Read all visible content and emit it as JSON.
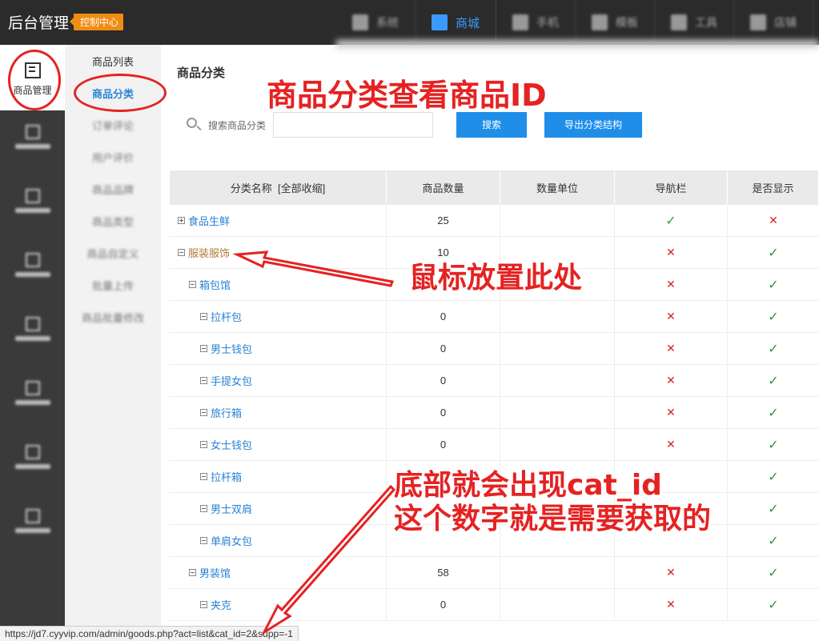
{
  "topbar": {
    "brand": "后台管理",
    "badge": "控制中心",
    "nav": [
      {
        "label": "系统",
        "active": false
      },
      {
        "label": "商城",
        "active": true
      },
      {
        "label": "手机",
        "active": false
      },
      {
        "label": "模板",
        "active": false
      },
      {
        "label": "工具",
        "active": false
      },
      {
        "label": "店铺",
        "active": false
      }
    ]
  },
  "sidebar": {
    "main_label": "商品管理"
  },
  "subnav": {
    "items": [
      {
        "label": "商品列表",
        "active": false,
        "blurred": false
      },
      {
        "label": "商品分类",
        "active": true,
        "blurred": false
      },
      {
        "label": "订单评论",
        "active": false,
        "blurred": true
      },
      {
        "label": "用户评价",
        "active": false,
        "blurred": true
      },
      {
        "label": "商品品牌",
        "active": false,
        "blurred": true
      },
      {
        "label": "商品类型",
        "active": false,
        "blurred": true
      },
      {
        "label": "商品自定义",
        "active": false,
        "blurred": true
      },
      {
        "label": "批量上传",
        "active": false,
        "blurred": true
      },
      {
        "label": "商品批量修改",
        "active": false,
        "blurred": true
      }
    ]
  },
  "content": {
    "title": "商品分类",
    "search_label": "搜索商品分类",
    "search_value": "",
    "search_button": "搜索",
    "export_button": "导出分类结构"
  },
  "table": {
    "headers": [
      "分类名称",
      "[全部收缩]",
      "商品数量",
      "数量单位",
      "导航栏",
      "是否显示"
    ],
    "rows": [
      {
        "name": "食品生鲜",
        "level": 0,
        "expanded": false,
        "count": "25",
        "unit": "",
        "nav": "✓",
        "show": "✕",
        "hover": false
      },
      {
        "name": "服装服饰",
        "level": 0,
        "expanded": true,
        "count": "10",
        "unit": "",
        "nav": "✕",
        "show": "✓",
        "hover": true
      },
      {
        "name": "箱包馆",
        "level": 1,
        "expanded": true,
        "count": "",
        "unit": "",
        "nav": "✕",
        "show": "✓",
        "hover": false
      },
      {
        "name": "拉杆包",
        "level": 2,
        "expanded": true,
        "count": "0",
        "unit": "",
        "nav": "✕",
        "show": "✓",
        "hover": false
      },
      {
        "name": "男士钱包",
        "level": 2,
        "expanded": true,
        "count": "0",
        "unit": "",
        "nav": "✕",
        "show": "✓",
        "hover": false
      },
      {
        "name": "手提女包",
        "level": 2,
        "expanded": true,
        "count": "0",
        "unit": "",
        "nav": "✕",
        "show": "✓",
        "hover": false
      },
      {
        "name": "旅行箱",
        "level": 2,
        "expanded": true,
        "count": "0",
        "unit": "",
        "nav": "✕",
        "show": "✓",
        "hover": false
      },
      {
        "name": "女士钱包",
        "level": 2,
        "expanded": true,
        "count": "0",
        "unit": "",
        "nav": "✕",
        "show": "✓",
        "hover": false
      },
      {
        "name": "拉杆箱",
        "level": 2,
        "expanded": true,
        "count": "",
        "unit": "",
        "nav": "",
        "show": "✓",
        "hover": false
      },
      {
        "name": "男士双肩",
        "level": 2,
        "expanded": true,
        "count": "",
        "unit": "",
        "nav": "",
        "show": "✓",
        "hover": false
      },
      {
        "name": "单肩女包",
        "level": 2,
        "expanded": true,
        "count": "",
        "unit": "",
        "nav": "",
        "show": "✓",
        "hover": false
      },
      {
        "name": "男装馆",
        "level": 1,
        "expanded": true,
        "count": "58",
        "unit": "",
        "nav": "✕",
        "show": "✓",
        "hover": false
      },
      {
        "name": "夹克",
        "level": 2,
        "expanded": true,
        "count": "0",
        "unit": "",
        "nav": "✕",
        "show": "✓",
        "hover": false
      }
    ]
  },
  "statusbar": {
    "url": "https://jd7.cyyvip.com/admin/goods.php?act=list&cat_id=2&supp=-1"
  },
  "annotations": {
    "title": "商品分类查看商品ID",
    "hover_hint": "鼠标放置此处",
    "bottom_line1": "底部就会出现cat_id",
    "bottom_line2": "这个数字就是需要获取的"
  },
  "colors": {
    "accent": "#1e8ee9",
    "link": "#2a83d6",
    "annotation": "#e52222",
    "yes": "#22a045",
    "no": "#e02020",
    "badge": "#f08c13"
  }
}
